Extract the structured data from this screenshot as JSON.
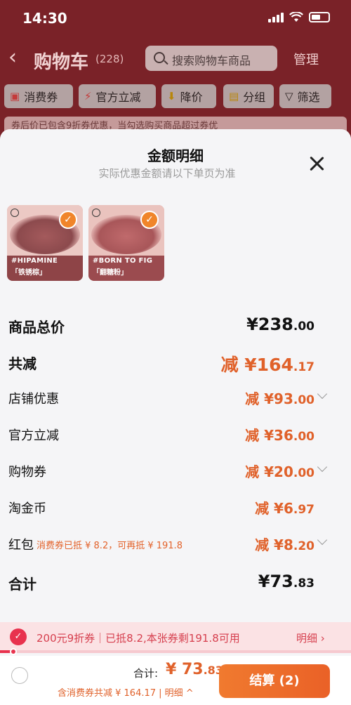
{
  "status_bar": {
    "time": "14:30"
  },
  "nav": {
    "back": "‹",
    "title": "购物车",
    "count": "(228)",
    "search_placeholder": "搜索购物车商品",
    "manage": "管理"
  },
  "chips": [
    {
      "icon": "▣",
      "label": "消费券"
    },
    {
      "icon": "⚡",
      "label": "官方立减"
    },
    {
      "icon": "⬇",
      "label": "降价"
    },
    {
      "icon": "▤",
      "label": "分组"
    },
    {
      "icon": "▽",
      "label": "筛选"
    }
  ],
  "banner": "券后价已包含9折券优惠，当勾选购买商品超过券优",
  "sheet": {
    "title": "金额明细",
    "subtitle": "实际优惠金额请以下单页为准",
    "products": [
      {
        "code": "#HIPAMINE",
        "shade": "「铁锈棕」"
      },
      {
        "code": "#BORN TO FIG",
        "shade": "「翻糖粉」"
      }
    ],
    "rows": [
      {
        "label": "商品总价",
        "main": "¥238",
        "cents": ".00"
      },
      {
        "label": "共减",
        "main": "减 ¥164",
        "cents": ".17"
      },
      {
        "label": "店铺优惠",
        "main": "减 ¥93",
        "cents": ".00"
      },
      {
        "label": "官方立减",
        "main": "减 ¥36",
        "cents": ".00"
      },
      {
        "label": "购物券",
        "main": "减 ¥20",
        "cents": ".00"
      },
      {
        "label": "淘金币",
        "main": "减 ¥6",
        "cents": ".97"
      },
      {
        "label": "红包",
        "note": "消费券已抵 ¥ 8.2，可再抵 ¥ 191.8",
        "main": "减 ¥8",
        "cents": ".20"
      },
      {
        "label": "合计",
        "main": "¥73",
        "cents": ".83"
      }
    ]
  },
  "coupon": {
    "text": "200元9折券｜已抵8.2,本张券剩191.8可用",
    "detail": "明细 ›",
    "progress_fraction": 0.04
  },
  "bottom_bar": {
    "total_label": "合计:",
    "total_main": "¥ 73",
    "total_cents": ".83",
    "total_sub": "含消费券共减 ¥ 164.17 | 明细 ^",
    "checkout": "结算 (2)"
  },
  "colors": {
    "accent": "#e0612a",
    "coupon": "#e8324e"
  }
}
